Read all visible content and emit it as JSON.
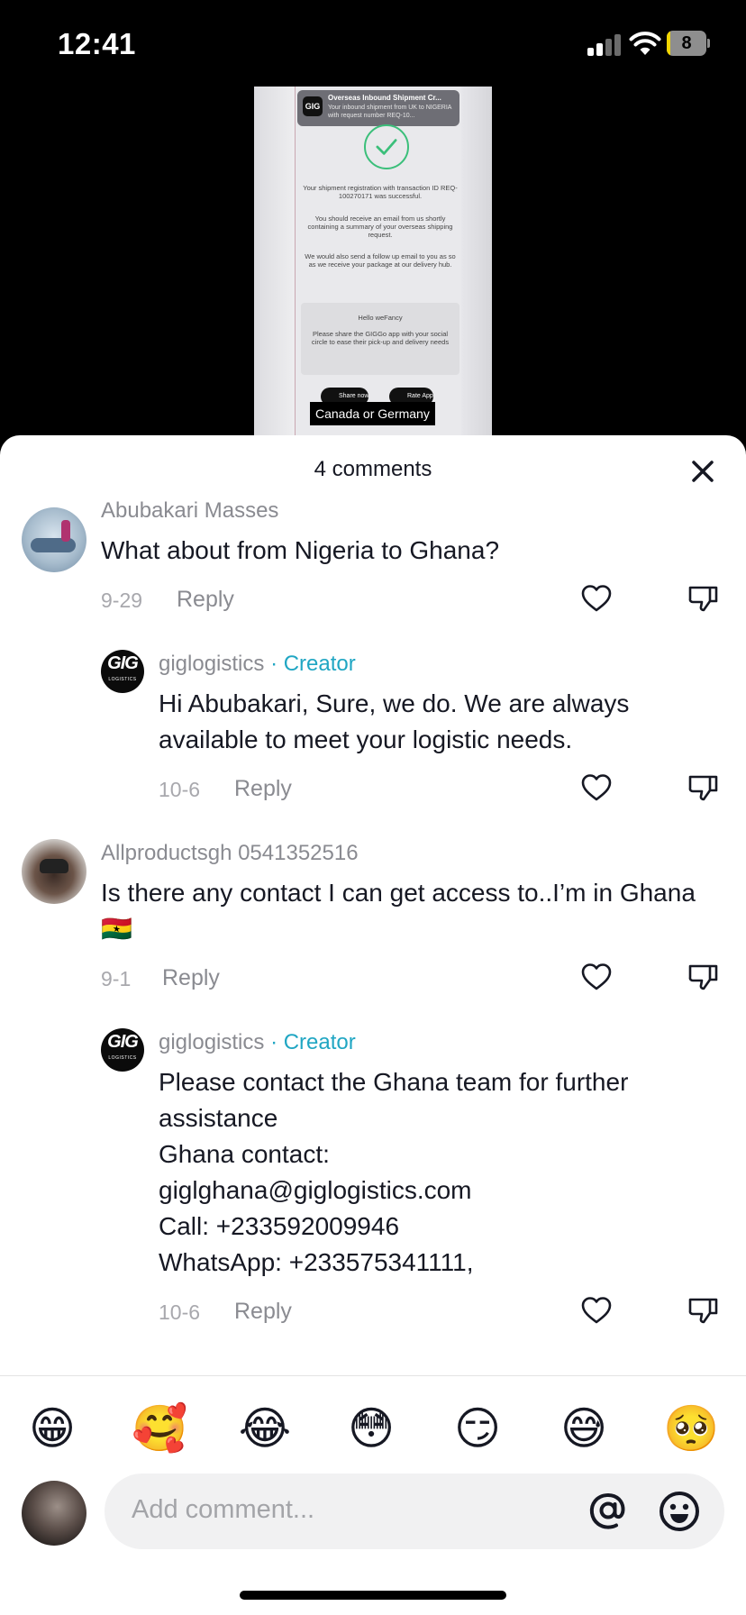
{
  "status_bar": {
    "time": "12:41",
    "battery": "8",
    "battery_level": 0.08
  },
  "video": {
    "notification_logo": "GIG",
    "notification_title": "Overseas Inbound Shipment Cr...",
    "notification_body": "Your inbound shipment from UK to NIGERIA with request number REQ-10...",
    "success_text": "Your shipment registration with transaction ID REQ-100270171 was successful.",
    "email_text": "You should receive an email from us shortly containing a summary of your overseas shipping request.",
    "followup_text": "We would also send a follow up email to you as so as we receive your package at our delivery hub.",
    "card_greeting": "Hello weFancy",
    "card_text": "Please share the GIGGo app with your social circle to ease their pick-up and delivery needs",
    "share_button": "Share now",
    "rate_button": "Rate App",
    "caption": "Canada or Germany"
  },
  "sheet": {
    "title": "4 comments"
  },
  "comments": [
    {
      "username": "Abubakari Masses",
      "text": "What about from Nigeria to Ghana?",
      "date": "9-29",
      "reply_label": "Reply"
    },
    {
      "username": "giglogistics",
      "badge": "· Creator",
      "text": "Hi Abubakari, Sure, we do. We are always available to meet your logistic needs.",
      "date": "10-6",
      "reply_label": "Reply"
    },
    {
      "username": "Allproductsgh 0541352516",
      "text": "Is there any contact I can get access to..I’m in Ghana 🇬🇭",
      "date": "9-1",
      "reply_label": "Reply"
    },
    {
      "username": "giglogistics",
      "badge": "· Creator",
      "lines": [
        "Please contact the Ghana team for further",
        "assistance",
        "Ghana contact:",
        "giglghana@giglogistics.com",
        "Call: +233592009946",
        "WhatsApp: +233575341111,"
      ],
      "date": "10-6",
      "reply_label": "Reply"
    }
  ],
  "gig_avatar": {
    "word": "GIG",
    "sub": "LOGISTICS"
  },
  "emoji_bar": [
    "😁",
    "🥰",
    "😂",
    "😳",
    "😏",
    "😅",
    "🥺"
  ],
  "composer": {
    "placeholder": "Add comment..."
  },
  "icons": {
    "close": "close-icon",
    "like": "heart-outline-icon",
    "dislike": "thumbs-down-icon",
    "mention": "at-icon",
    "emoji": "smiley-icon"
  },
  "colors": {
    "creator": "#20a6c3",
    "text": "#161823",
    "muted": "#8a8b91"
  }
}
